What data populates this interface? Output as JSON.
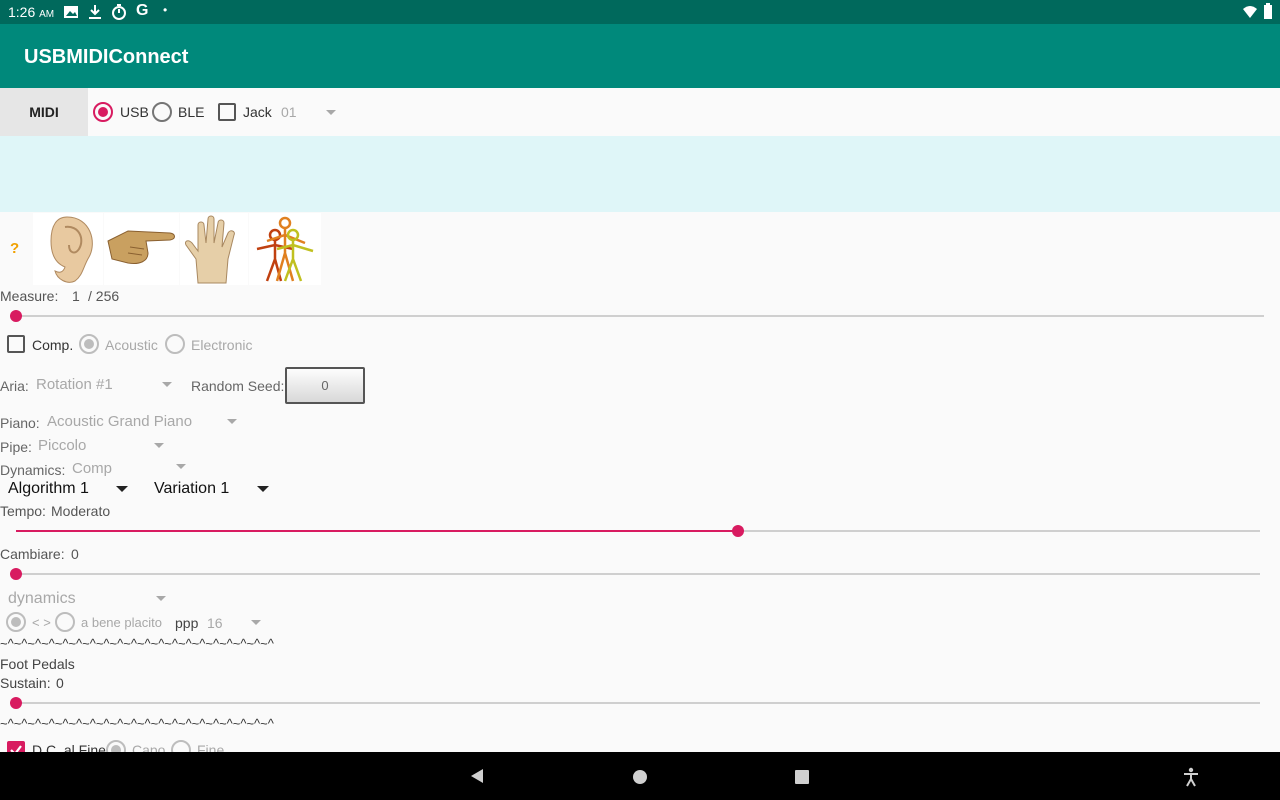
{
  "status_bar": {
    "time": "1:26",
    "ampm": "AM"
  },
  "app_title": "USBMIDIConnect",
  "toolbar": {
    "midi_button": "MIDI",
    "usb_label": "USB",
    "ble_label": "BLE",
    "jack_label": "Jack",
    "jack_value": "01"
  },
  "help_label": "?",
  "measure": {
    "label": "Measure:",
    "current": "1",
    "total": "/ 256",
    "position": 0.0
  },
  "comp": {
    "label": "Comp.",
    "acoustic": "Acoustic",
    "electronic": "Electronic"
  },
  "aria": {
    "label": "Aria:",
    "value": "Rotation #1",
    "seed_label": "Random Seed:",
    "seed_value": "0"
  },
  "piano": {
    "label": "Piano:",
    "value": "Acoustic Grand Piano"
  },
  "pipe": {
    "label": "Pipe:",
    "value": "Piccolo"
  },
  "dynamics": {
    "label": "Dynamics:",
    "value": "Comp"
  },
  "algorithm": "Algorithm 1",
  "variation": "Variation 1",
  "tempo": {
    "label": "Tempo:",
    "value": "Moderato",
    "position": 0.58
  },
  "cambiare": {
    "label": "Cambiare:",
    "value": "0",
    "position": 0.0
  },
  "dyn_select": "dynamics",
  "dyn_opts": {
    "cresc": "< >",
    "placito": "a bene placito",
    "level": "ppp",
    "count": "16"
  },
  "separator": "~^~^~^~^~^~^~^~^~^~^~^~^~^~^~^~^~^~^~^~^",
  "foot_pedals": {
    "label": "Foot Pedals",
    "sustain_label": "Sustain:",
    "sustain_value": "0",
    "position": 0.0
  },
  "dc": {
    "label": "D.C. al Fine",
    "capo": "Capo",
    "fine": "Fine"
  },
  "colors": {
    "teal": "#00897b",
    "teal_dark": "#00695c",
    "accent": "#d81b60",
    "band": "#dff6f8"
  },
  "icons": [
    "ear-icon",
    "pointing-hand-icon",
    "open-hand-icon",
    "dancers-icon"
  ]
}
